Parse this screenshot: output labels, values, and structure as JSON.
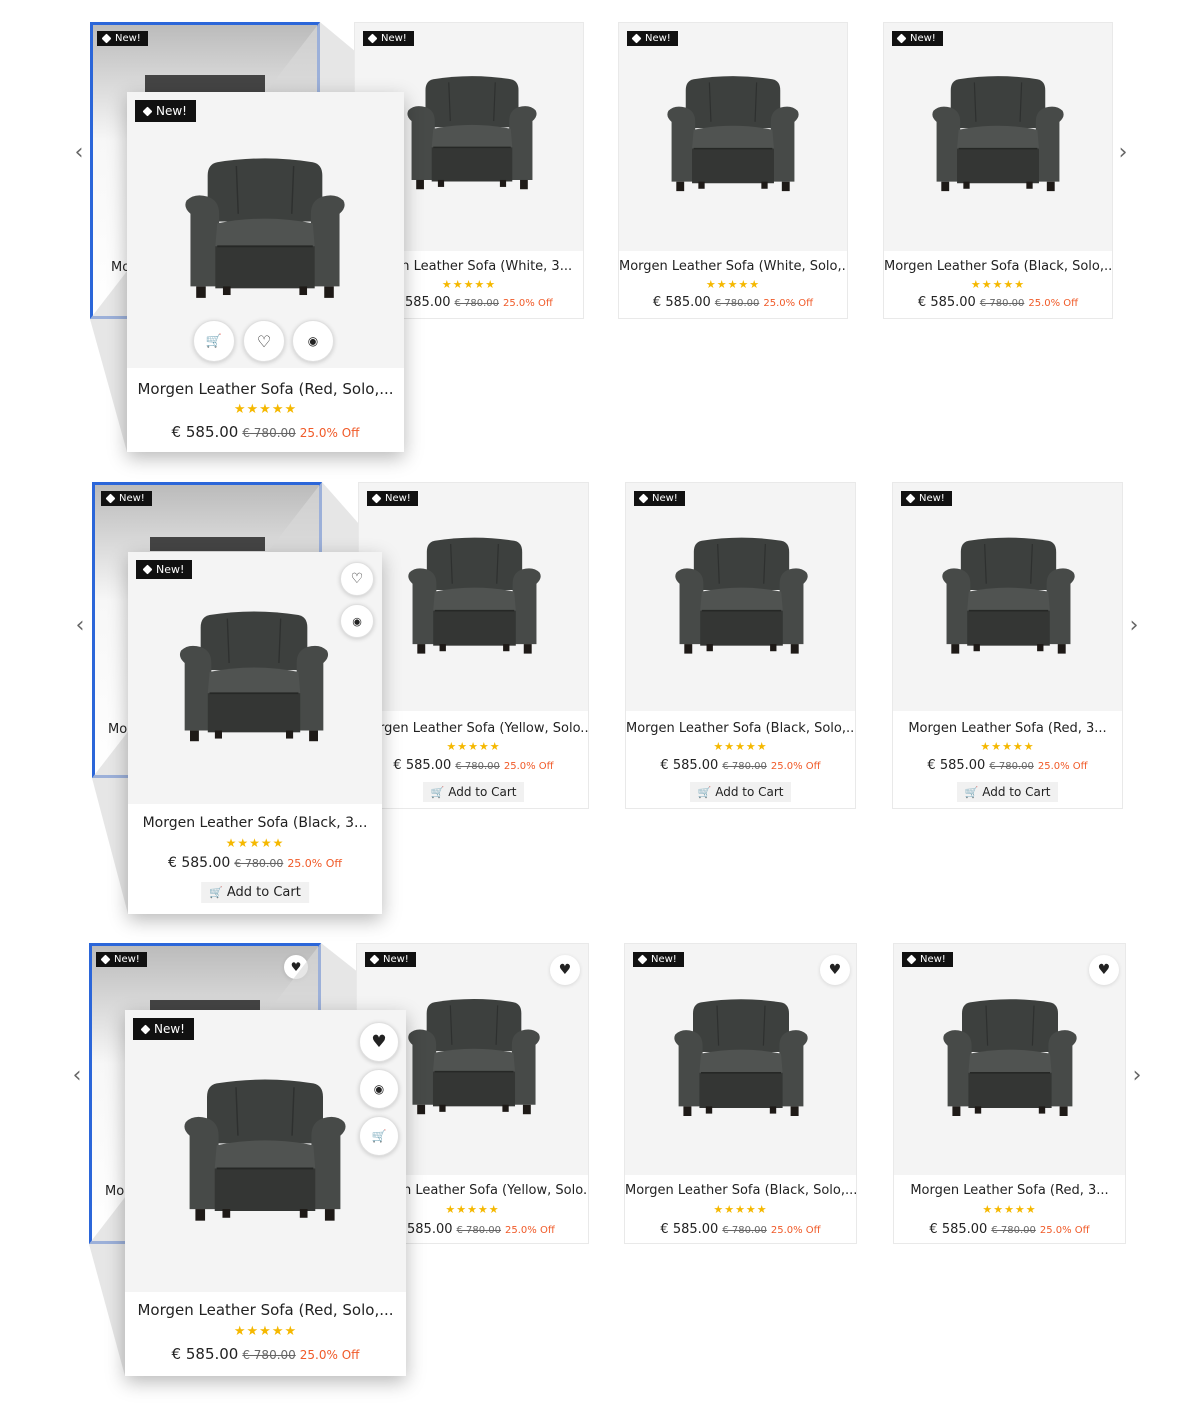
{
  "badge": "New!",
  "stars": "★★★★★",
  "price": "€ 585.00",
  "old_price": "€ 780.00",
  "discount": "25.0% Off",
  "add_to_cart": "Add to Cart",
  "colors": {
    "accent": "#2b66d9",
    "discount": "#f05a28",
    "star": "#f5b800",
    "badge_bg": "#111111"
  },
  "icons": {
    "prev": "chevron-left-icon",
    "next": "chevron-right-icon",
    "cart": "cart-icon",
    "wishlist": "heart-icon",
    "quickview": "eye-icon",
    "tag": "tag-icon"
  },
  "row1": {
    "base_name": "Mo",
    "popup_name": "Morgen Leather Sofa (Red, Solo,...",
    "names": [
      "gen Leather Sofa (White, 3...",
      "Morgen Leather Sofa (White, Solo,...",
      "Morgen Leather Sofa (Black, Solo,..."
    ],
    "prices": [
      "585.00",
      "€ 585.00",
      "€ 585.00"
    ]
  },
  "row2": {
    "base_name": "Mo",
    "popup_name": "Morgen Leather Sofa (Black, 3...",
    "names": [
      "rgen Leather Sofa (Yellow, Solo...",
      "Morgen Leather Sofa (Black, Solo,...",
      "Morgen Leather Sofa (Red, 3..."
    ],
    "prices": [
      "€ 585.00",
      "€ 585.00",
      "€ 585.00"
    ]
  },
  "row3": {
    "base_name": "Mo",
    "popup_name": "Morgen Leather Sofa (Red, Solo,...",
    "names": [
      "n Leather Sofa (Yellow, Solo...",
      "Morgen Leather Sofa (Black, Solo,...",
      "Morgen Leather Sofa (Red, 3..."
    ],
    "prices": [
      "585.00",
      "€ 585.00",
      "€ 585.00"
    ]
  }
}
